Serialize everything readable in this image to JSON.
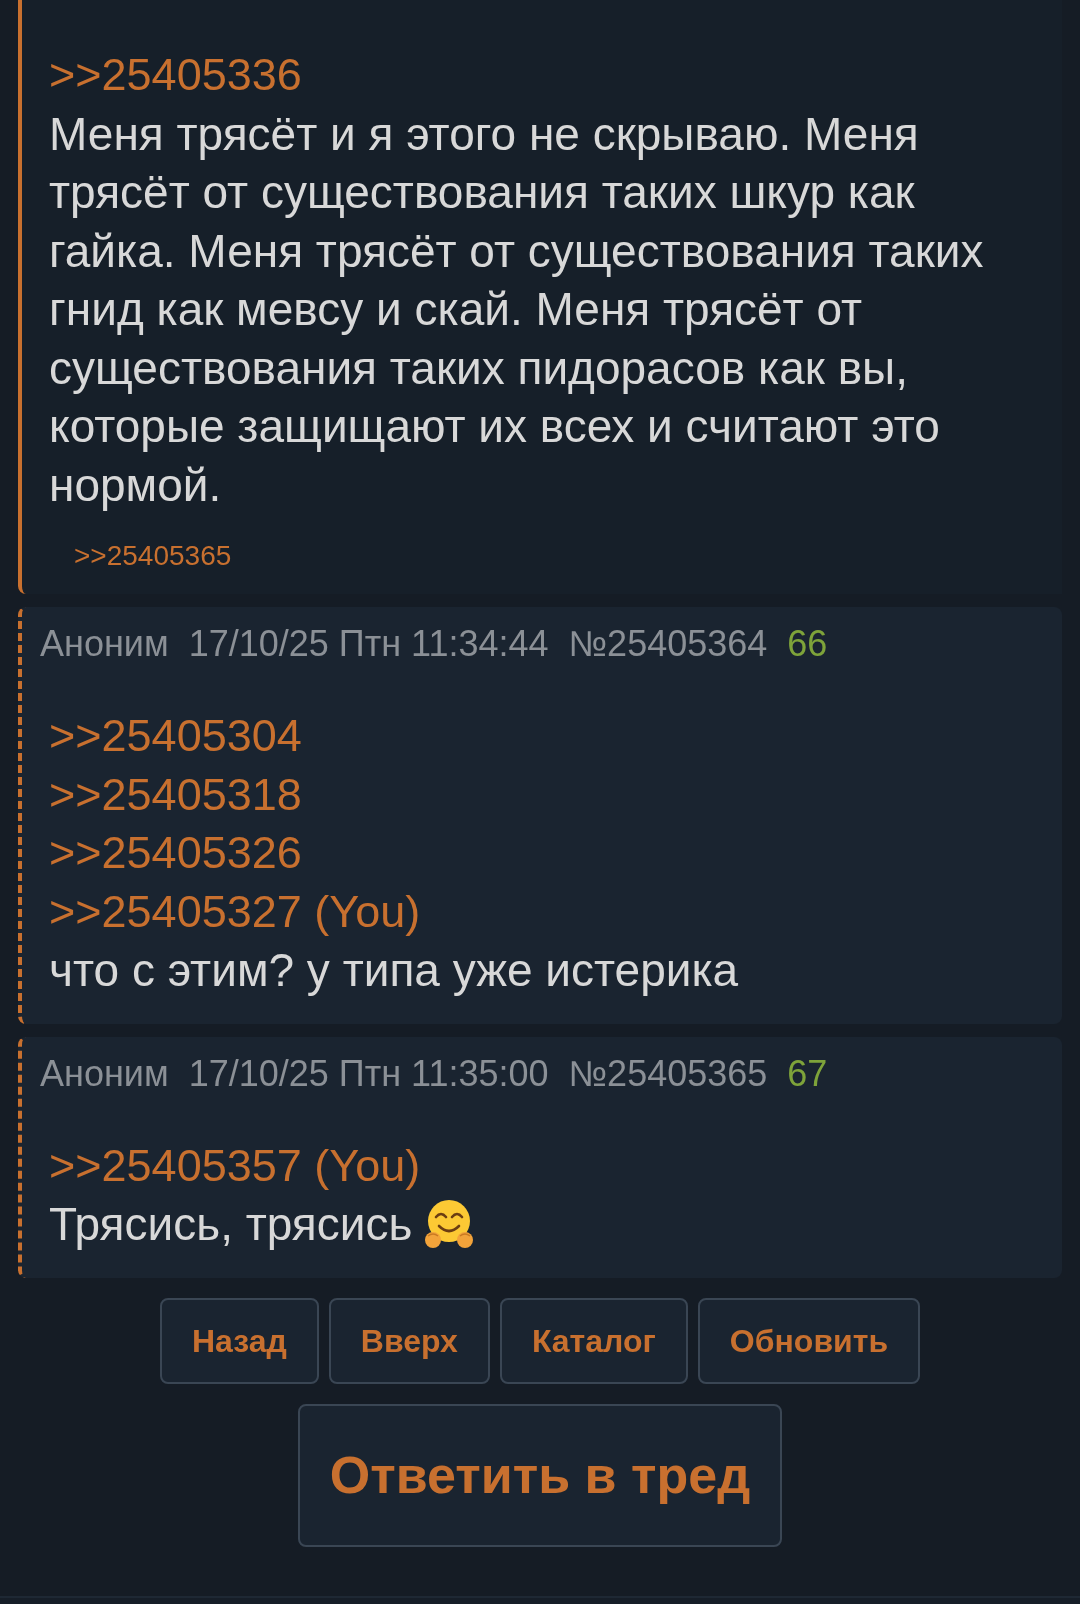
{
  "posts": [
    {
      "kind": "solid",
      "quotes": [
        ">>25405336"
      ],
      "text": "Меня трясёт и я этого не скрываю. Меня трясёт от существования таких шкур как гайка. Меня трясёт от существования таких гнид как мевсу и скай. Меня трясёт от существования таких пидорасов как вы, которые защищают их всех и считают это нормой.",
      "replies": [
        ">>25405365"
      ]
    },
    {
      "kind": "dashed",
      "header": {
        "author": "Аноним",
        "date": "17/10/25 Птн 11:34:44",
        "number": "№25405364",
        "index": "66"
      },
      "quotes": [
        ">>25405304",
        ">>25405318",
        ">>25405326",
        ">>25405327 (You)"
      ],
      "text": "что с этим? у типа уже истерика"
    },
    {
      "kind": "dashed",
      "header": {
        "author": "Аноним",
        "date": "17/10/25 Птн 11:35:00",
        "number": "№25405365",
        "index": "67"
      },
      "quotes": [
        ">>25405357 (You)"
      ],
      "text": "Трясись, трясись",
      "emoji": true
    }
  ],
  "nav_buttons": [
    "Назад",
    "Вверх",
    "Каталог",
    "Обновить"
  ],
  "reply_button": "Ответить в тред"
}
